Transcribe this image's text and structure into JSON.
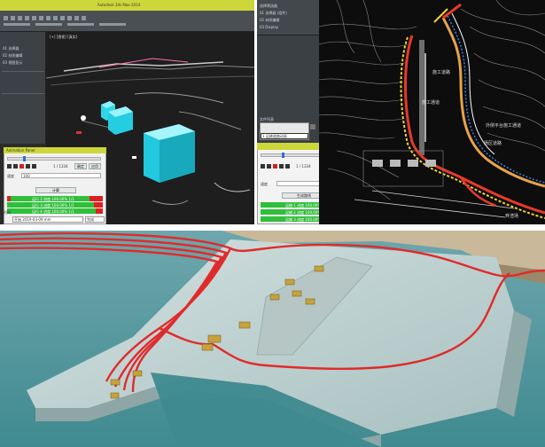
{
  "left_app": {
    "title_bar_text": "Autodesk 3ds Max 2014",
    "accent": "#d4e04a",
    "panel_items": [
      "01 选择器",
      "02 材质编辑",
      "03 视图显示"
    ],
    "viewport_label": "[+] [透视] [真实]",
    "anim_panel": {
      "title": "Animation Panel",
      "frame_field": "1 / 1334",
      "ok_label": "确定",
      "apply_label": "应用",
      "speed_label": "速度",
      "speed_value": "100",
      "compute_label": "计算",
      "rows": [
        "运行 2 进度 100.00% 1/1",
        "运行 3 进度 100.00% 1/1",
        "运行 4 进度 100.00% 1/1"
      ],
      "bottom_label": "时间",
      "bottom_value": "开始 2019-03-09 mm",
      "bottom_label2": "完成"
    }
  },
  "middle_app": {
    "header_items": [
      "选择筛选器",
      "01 选择器 (组件)",
      "02 材质编辑",
      "03 Display"
    ],
    "list_label": "文件列表",
    "list_selected": "1 运输道路动画",
    "anim_panel": {
      "frame_field": "1 / 1334",
      "ok_label": "确定",
      "apply_label": "应用",
      "speed_label": "速度",
      "compute_label": "生成路线",
      "rows": [
        "运输 1 进度 100.00% 1/1",
        "运输 2 进度 100.00% 1/1",
        "运输 3 进度 100.00% 1/1"
      ],
      "progress": [
        0.82,
        0.78,
        1.0
      ]
    }
  },
  "cad_map": {
    "labels": [
      "施工道路",
      "外侧平台施工通道",
      "施工通道",
      "场区道路",
      "弃渣场"
    ],
    "route_colors": [
      "#e53a2a",
      "#f2d23a",
      "#3b7de8",
      "#ffffff",
      "#e8a24a"
    ],
    "background": "#0d0d0d"
  },
  "render_3d": {
    "water_color": "#7fb3b7",
    "platform_color": "#b9cfcf",
    "route_color": "#e02b2b",
    "vehicle_color": "#c8a23a"
  }
}
